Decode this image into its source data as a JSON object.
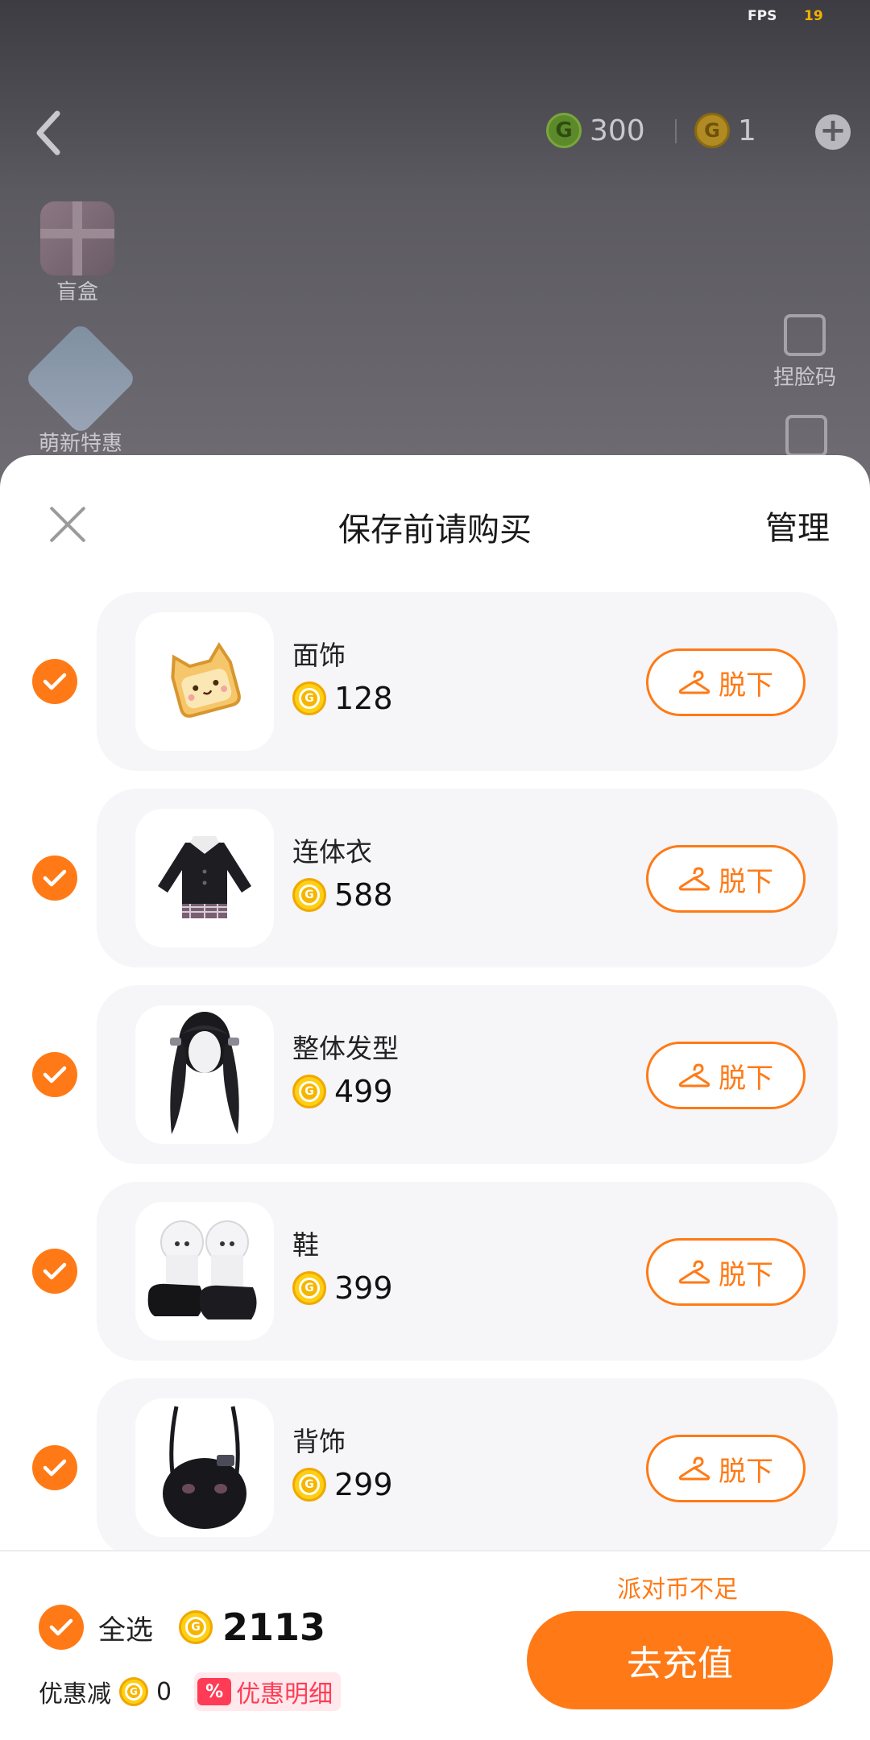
{
  "status": {
    "fps_label": "FPS",
    "fps_value": "19"
  },
  "top_bar": {
    "green_coin_amount": "300",
    "gold_coin_amount": "1"
  },
  "side_menu": {
    "blind_box_label": "盲盒",
    "newbie_label": "萌新特惠",
    "pinch_face_label": "捏脸码"
  },
  "sheet": {
    "title": "保存前请购买",
    "manage_label": "管理",
    "items": [
      {
        "name": "面饰",
        "price": "128",
        "action": "脱下"
      },
      {
        "name": "连体衣",
        "price": "588",
        "action": "脱下"
      },
      {
        "name": "整体发型",
        "price": "499",
        "action": "脱下"
      },
      {
        "name": "鞋",
        "price": "399",
        "action": "脱下"
      },
      {
        "name": "背饰",
        "price": "299",
        "action": "脱下"
      }
    ]
  },
  "footer": {
    "warning": "派对币不足",
    "select_all_label": "全选",
    "total": "2113",
    "discount_label": "优惠减",
    "discount_value": "0",
    "discount_badge": "%",
    "discount_detail_label": "优惠明细",
    "recharge_label": "去充值"
  },
  "colors": {
    "accent": "#ff7a16",
    "discount_red": "#ff3c55"
  }
}
